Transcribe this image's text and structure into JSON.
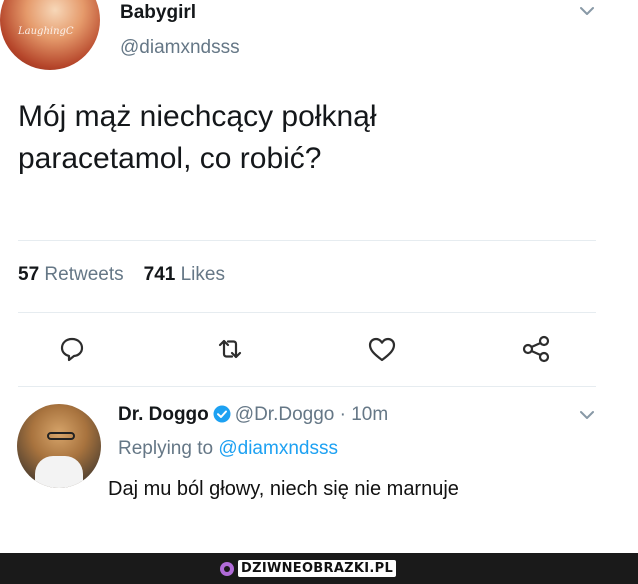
{
  "tweet": {
    "author_name": "Babygirl",
    "author_handle": "@diamxndsss",
    "avatar_watermark": "LaughingC",
    "text_line1": "Mój mąż niechcący połknął",
    "text_line2": "paracetamol, co robić?",
    "retweets_count": "57",
    "retweets_label": "Retweets",
    "likes_count": "741",
    "likes_label": "Likes"
  },
  "actions": {
    "icons": [
      "reply-icon",
      "retweet-icon",
      "like-icon",
      "share-icon"
    ]
  },
  "reply": {
    "name": "Dr. Doggo",
    "handle": "@Dr.Doggo",
    "separator": "·",
    "time": "10m",
    "replying_prefix": "Replying to",
    "replying_to": "@diamxndsss",
    "text": "Daj mu ból głowy, niech się nie marnuje"
  },
  "footer": {
    "site": "DZIWNEOBRAZKI.PL"
  },
  "colors": {
    "text": "#14171a",
    "muted": "#657786",
    "link": "#1da1f2",
    "divider": "#e6ecf0",
    "footer_bg": "#1a1a1a",
    "logo_accent": "#b06bd8"
  }
}
